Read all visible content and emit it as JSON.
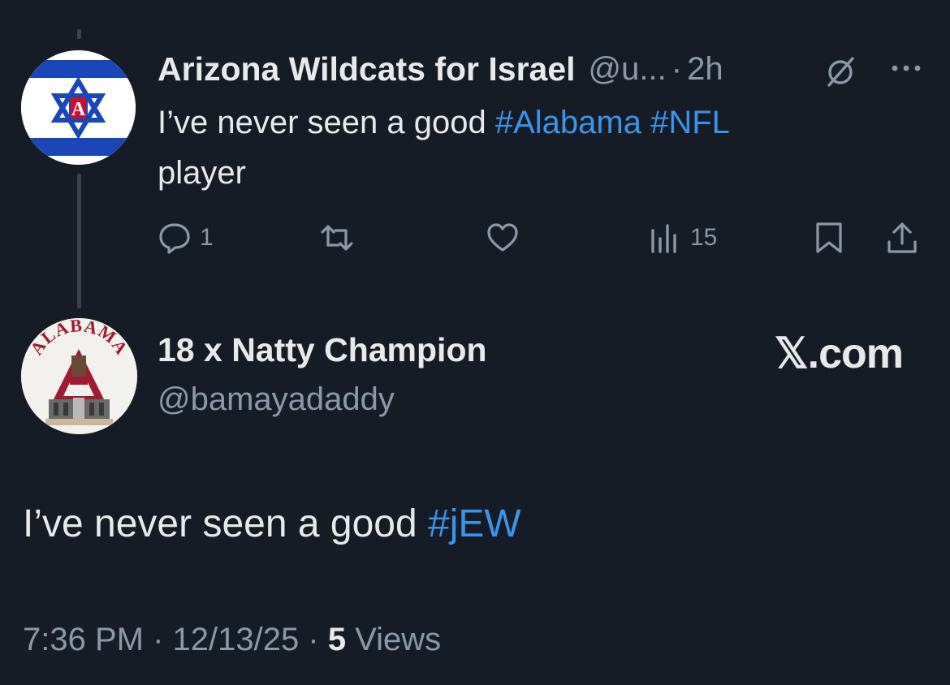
{
  "tweet1": {
    "display_name": "Arizona Wildcats for Israel",
    "handle": "@u...",
    "separator": "·",
    "time": "2h",
    "text_plain": "I’ve never seen a good ",
    "hashtag1": "#Alabama",
    "hashtag2": "#NFL",
    "text_end": "player",
    "replies": "1",
    "views": "15",
    "avatar_letter": "A"
  },
  "tweet2": {
    "display_name": "18 x Natty Champion",
    "handle": "@bamayadaddy",
    "avatar_text": "ALABAMA",
    "text_plain": "I’ve never seen a good ",
    "hashtag": "#jEW",
    "time": "7:36 PM",
    "date": "12/13/25",
    "separator": "·",
    "views_count": "5",
    "views_label": "Views"
  },
  "watermark": "𝕏.com",
  "colors": {
    "background": "#161c26",
    "text": "#e7e9ea",
    "muted": "#8b98a5",
    "link": "#3b94e8",
    "israel_blue": "#1a47b8",
    "alabama_crimson": "#9e1b32"
  },
  "icons": [
    "reply-icon",
    "retweet-icon",
    "like-icon",
    "views-icon",
    "bookmark-icon",
    "share-icon",
    "grok-icon",
    "more-icon"
  ]
}
